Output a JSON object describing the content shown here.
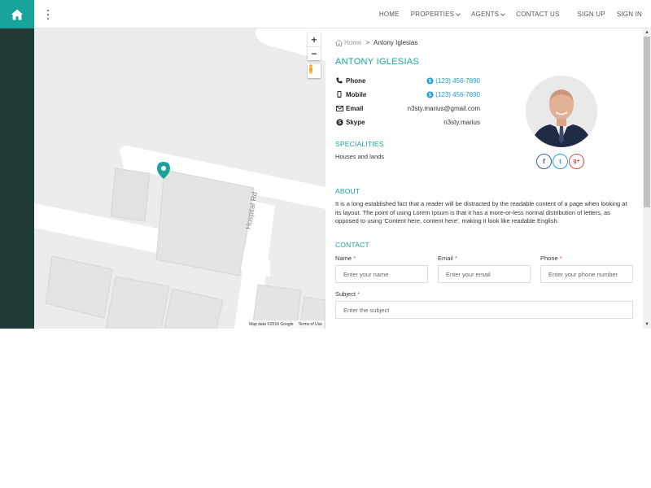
{
  "header": {
    "home_icon": "home-icon",
    "menu_icon": "kebab-menu-icon",
    "nav": [
      {
        "label": "HOME",
        "dropdown": false
      },
      {
        "label": "PROPERTIES",
        "dropdown": true
      },
      {
        "label": "AGENTS",
        "dropdown": true
      },
      {
        "label": "CONTACT US",
        "dropdown": false
      },
      {
        "label": "SIGN UP",
        "dropdown": false
      },
      {
        "label": "SIGN IN",
        "dropdown": false
      }
    ],
    "accent_color": "#19a39b"
  },
  "map": {
    "road_label": "Hospital Rd",
    "zoom_in": "+",
    "zoom_out": "−",
    "attribution": "Map data ©2016 Google",
    "terms": "Terms of Use",
    "marker_icon": "map-marker-icon"
  },
  "breadcrumb": {
    "home": "Home",
    "separator": ">",
    "current": "Antony Iglesias"
  },
  "agent": {
    "name": "ANTONY IGLESIAS",
    "contacts": [
      {
        "icon": "phone-icon",
        "label": "Phone",
        "value": "(123) 456-7890",
        "value_icon": "skype-icon"
      },
      {
        "icon": "mobile-icon",
        "label": "Mobile",
        "value": "(123) 456-7890",
        "value_icon": "skype-icon"
      },
      {
        "icon": "envelope-icon",
        "label": "Email",
        "value": "n3sty.marius@gmail.com"
      },
      {
        "icon": "skype-icon",
        "label": "Skype",
        "value": "n3sty.marius"
      }
    ],
    "social": [
      {
        "icon": "facebook-icon",
        "glyph": "f",
        "color": "#3b5998"
      },
      {
        "icon": "twitter-icon",
        "glyph": "t",
        "color": "#1da1f2"
      },
      {
        "icon": "google-plus-icon",
        "glyph": "g+",
        "color": "#dd4b39"
      }
    ]
  },
  "specialities": {
    "title": "SPECIALITIES",
    "text": "Houses and lands"
  },
  "about": {
    "title": "ABOUT",
    "text": "It is a long established fact that a reader will be distracted by the readable content of a page when looking at its layout. The point of using Lorem Ipsum is that it has a more-or-less normal distribution of letters, as opposed to using 'Content here, content here', making it look like readable English."
  },
  "contact_form": {
    "title": "CONTACT",
    "name_label": "Name",
    "name_placeholder": "Enter your name",
    "email_label": "Email",
    "email_placeholder": "Enter your email",
    "phone_label": "Phone",
    "phone_placeholder": "Enter your phone number",
    "subject_label": "Subject",
    "subject_placeholder": "Enter the subject",
    "required_mark": "*"
  }
}
